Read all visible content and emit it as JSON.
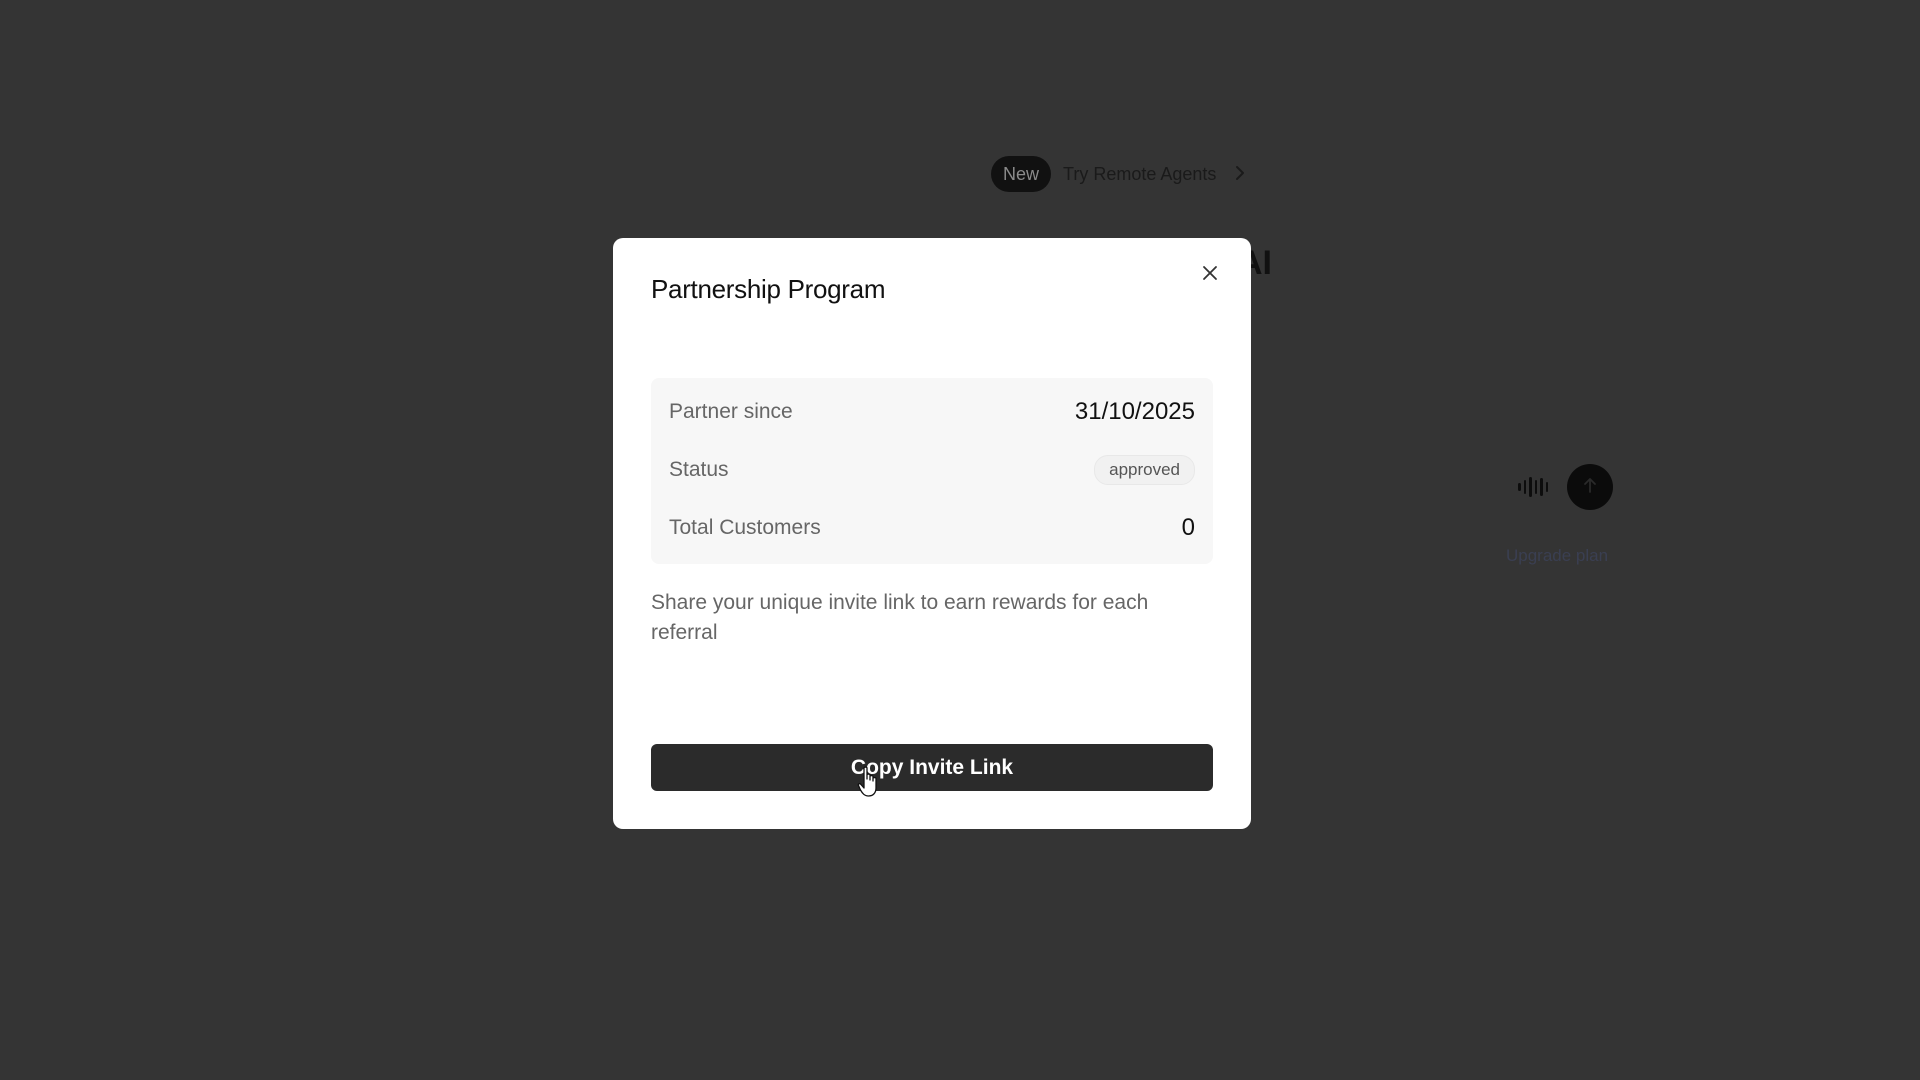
{
  "background": {
    "announcement": {
      "badge": "New",
      "text": "Try Remote Agents",
      "chevron_icon": "chevron-right-icon"
    },
    "heading_fragment": "AI",
    "voice_icon": "waveform-icon",
    "send_icon": "arrow-up-icon",
    "upgrade_link": "Upgrade plan"
  },
  "modal": {
    "title": "Partnership Program",
    "close_icon": "close-icon",
    "info": {
      "partner_since_label": "Partner since",
      "partner_since_value": "31/10/2025",
      "status_label": "Status",
      "status_value": "approved",
      "total_customers_label": "Total Customers",
      "total_customers_value": "0"
    },
    "description": "Share your unique invite link to earn rewards for each referral",
    "copy_button_label": "Copy Invite Link"
  },
  "colors": {
    "overlay": "#343434",
    "modal_bg": "#ffffff",
    "card_bg": "#f7f7f7",
    "button_bg": "#2b2b2b",
    "button_text": "#ffffff"
  }
}
